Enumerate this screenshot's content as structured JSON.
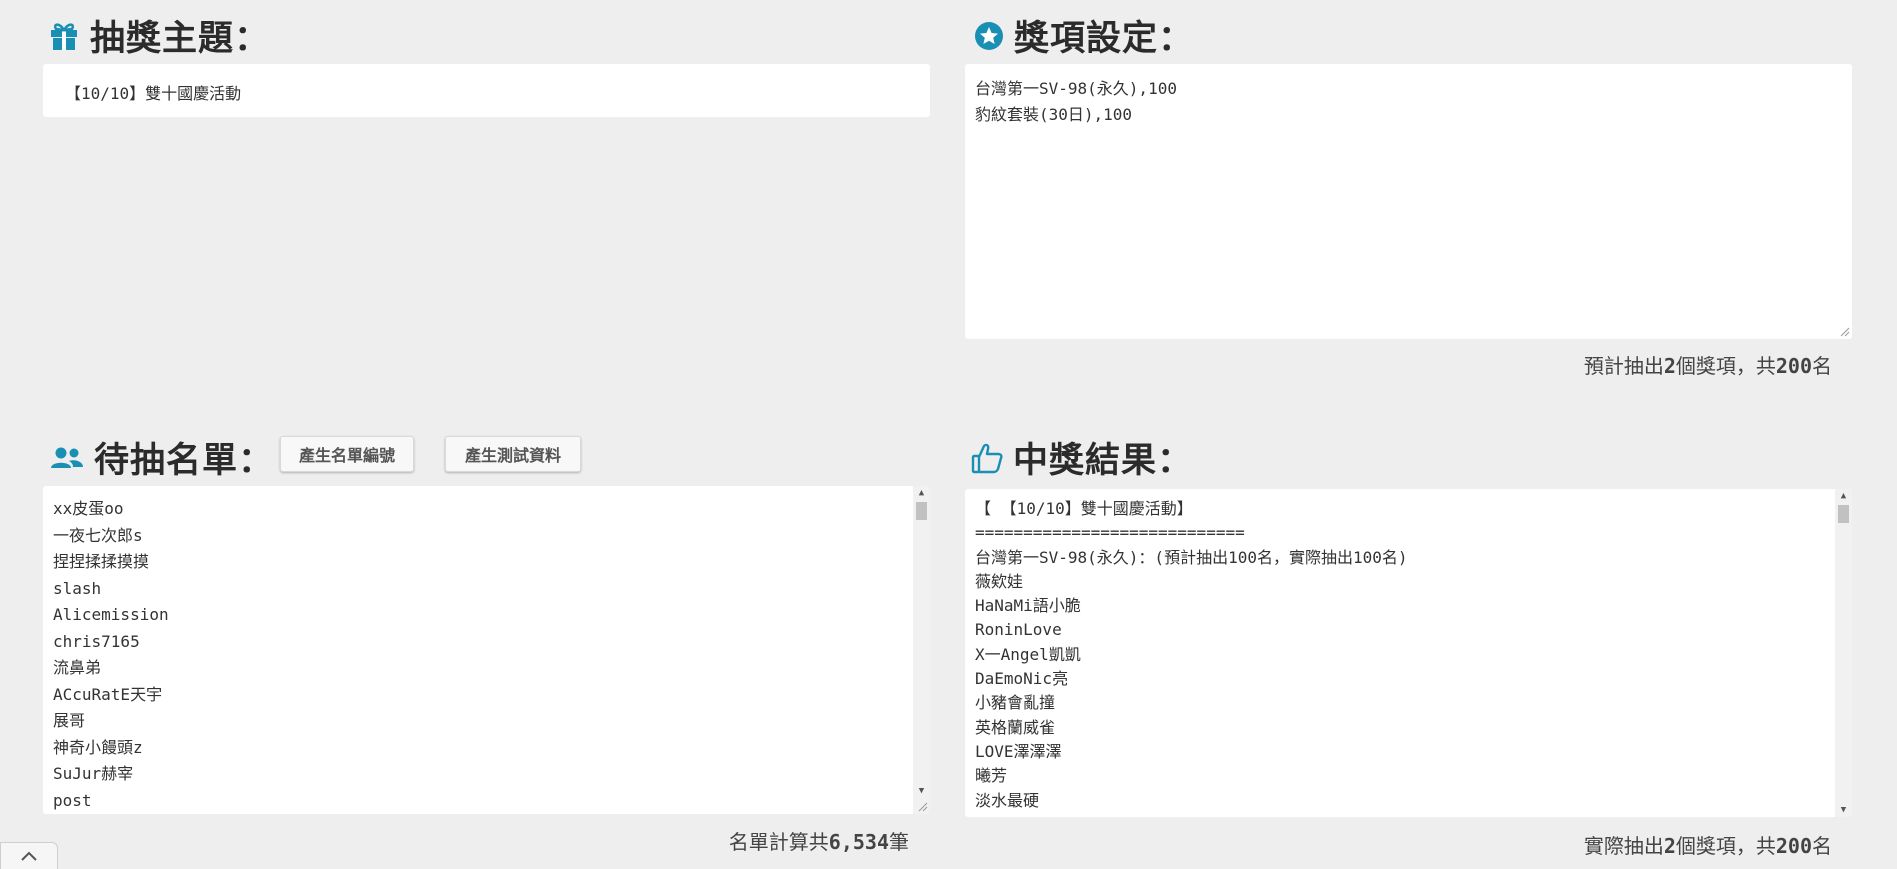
{
  "colors": {
    "accent": "#1a8fb4",
    "background": "#eeeeee",
    "panel": "#ffffff"
  },
  "topic": {
    "title": "抽獎主題：",
    "icon": "gift-icon",
    "value": "【10/10】雙十國慶活動"
  },
  "prizes": {
    "title": "獎項設定：",
    "icon": "star-icon",
    "lines": [
      "台灣第一SV-98(永久),100",
      "豹紋套裝(30日),100"
    ],
    "summary_prefix": "預計抽出",
    "summary_prize_count": "2",
    "summary_middle": "個獎項，共",
    "summary_total": "200",
    "summary_suffix": "名"
  },
  "candidates": {
    "title": "待抽名單：",
    "icon": "users-icon",
    "btn_number": "產生名單編號",
    "btn_test": "產生測試資料",
    "names": [
      "xx皮蛋oo",
      "一夜七次郎s",
      "捏捏揉揉摸摸",
      "slash",
      "Alicemission",
      "chris7165",
      "流鼻弟",
      "ACcuRatE天宇",
      "展哥",
      "神奇小饅頭z",
      "SuJur赫宰",
      "post"
    ],
    "count_prefix": "名單計算共",
    "count_value": "6,534",
    "count_suffix": "筆"
  },
  "results": {
    "title": "中獎結果：",
    "icon": "thumbs-up-icon",
    "lines": [
      "【 【10/10】雙十國慶活動】",
      "============================",
      "台灣第一SV-98(永久)：(預計抽出100名，實際抽出100名)",
      "薇欸娃",
      "HaNaMi語小脆",
      "RoninLove",
      "X一Angel凱凱",
      "DaEmoNic亮",
      "小豬會亂撞",
      "英格蘭威雀",
      "LOVE澤澤澤",
      "曦芳",
      "淡水最硬"
    ],
    "summary_prefix": "實際抽出",
    "summary_prize_count": "2",
    "summary_middle": "個獎項，共",
    "summary_total": "200",
    "summary_suffix": "名"
  },
  "back_to_top_icon": "chevron-up-icon"
}
